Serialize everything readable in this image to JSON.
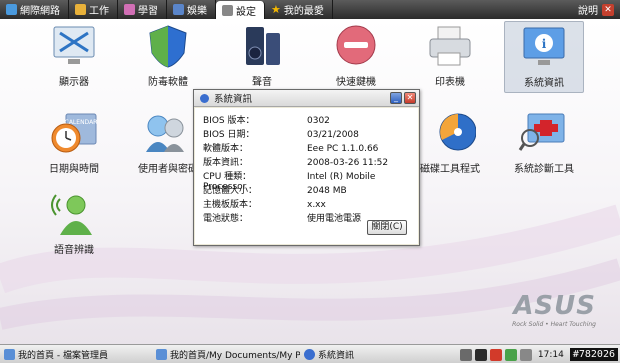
{
  "tabs": [
    {
      "label": "網際網路",
      "color": "#4a9ade"
    },
    {
      "label": "工作",
      "color": "#e8b13a"
    },
    {
      "label": "學習",
      "color": "#d16fb5"
    },
    {
      "label": "娛樂",
      "color": "#5a85c9"
    },
    {
      "label": "設定",
      "color": "#888888"
    },
    {
      "label": "我的最愛",
      "color": "#f5b800"
    }
  ],
  "active_tab": "設定",
  "help_label": "說明",
  "apps": [
    {
      "label": "顯示器"
    },
    {
      "label": "防毒軟體"
    },
    {
      "label": "聲音"
    },
    {
      "label": "快速鍵機"
    },
    {
      "label": "印表機"
    },
    {
      "label": "系統資訊"
    },
    {
      "label": "日期與時間"
    },
    {
      "label": "使用者與密碼"
    },
    {
      "label": "磁碟工具程式"
    },
    {
      "label": "系統診斷工具"
    },
    {
      "label": "語音辨識"
    }
  ],
  "brand": {
    "name": "ASUS",
    "tagline": "Rock Solid • Heart Touching"
  },
  "dialog": {
    "title": "系統資訊",
    "rows": [
      {
        "key": "BIOS 版本：",
        "value": "0302"
      },
      {
        "key": "BIOS 日期：",
        "value": "03/21/2008"
      },
      {
        "key": "軟體版本：",
        "value": "Eee PC 1.1.0.66"
      },
      {
        "key": "版本資訊：",
        "value": "2008-03-26 11:52"
      },
      {
        "key": "CPU 種類：",
        "value": "Intel (R) Mobile Processor"
      },
      {
        "key": "記憶體大小：",
        "value": "2048 MB"
      },
      {
        "key": "主機板版本：",
        "value": "x.xx"
      },
      {
        "key": "電池狀態：",
        "value": "使用電池電源"
      }
    ],
    "close_button": "關閉(C)"
  },
  "taskbar": {
    "tasks": [
      {
        "label": "我的首頁 - 檔案管理員"
      },
      {
        "label": "我的首頁/My Documents/My P"
      },
      {
        "label": "系統資訊"
      }
    ],
    "clock": "17:14",
    "badge": "#782026"
  }
}
